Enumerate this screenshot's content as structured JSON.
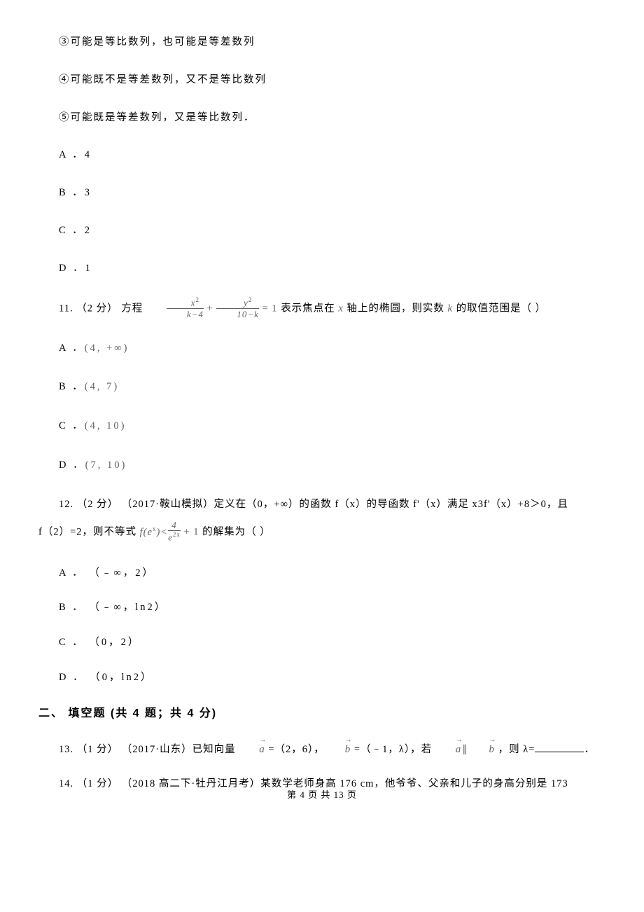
{
  "stmt3": "③可能是等比数列，也可能是等差数列",
  "stmt4": "④可能既不是等差数列，又不是等比数列",
  "stmt5": "⑤可能既是等差数列，又是等比数列．",
  "opt_a4": "A ．4",
  "opt_b3": "B ．3",
  "opt_c2": "C ．2",
  "opt_d1": "D ．1",
  "q11": {
    "prefix": "11.  （2 分） 方程 ",
    "eq_frac1_num": "x",
    "eq_frac1_sup": "2",
    "eq_frac1_den": "k−4",
    "plus": " + ",
    "eq_frac2_num": "y",
    "eq_frac2_sup": "2",
    "eq_frac2_den": "10−k",
    "eq_rhs": " = 1",
    "mid1": " 表示焦点在 ",
    "xvar": "x",
    "mid2": " 轴上的椭圆，则实数 ",
    "kvar": "k",
    "tail": " 的取值范围是（     ）",
    "optA_label": "A ．",
    "optA_val": "(4, +∞)",
    "optB_label": "B ．",
    "optB_val": "(4, 7)",
    "optC_label": "C ．",
    "optC_val": "(4, 10)",
    "optD_label": "D ．",
    "optD_val": "(7, 10)"
  },
  "q12": {
    "line1_a": "12.  （2 分） （2017·鞍山模拟）定义在（0，+∞）的函数 f（x）的导函数 f'（x）满足 x3f'（x）+8＞0，且",
    "line2_a": "f（2）=2，则不等式 ",
    "ineq_lhs": "f(e",
    "ineq_lhs_sup": "x",
    "ineq_lhs_close": ")<",
    "ineq_frac_num": "4",
    "ineq_frac_den_base": "e",
    "ineq_frac_den_sup": "2x",
    "ineq_rhs": " + 1",
    "line2_b": " 的解集为（     ）",
    "optA": "A ． （﹣∞，2）",
    "optB": "B ． （﹣∞，ln2）",
    "optC": "C ． （0，2）",
    "optD": "D ． （0，ln2）"
  },
  "section2": "二、 填空题 (共 4 题；共 4 分)",
  "q13": {
    "prefix": "13.  （1 分） （2017·山东）已知向量 ",
    "vec_a": "a",
    "mid1": " =（2，6），",
    "vec_b": "b",
    "mid2": " =（﹣1，λ），若 ",
    "vec_a2": "a",
    "parallel": "∥",
    "vec_b2": "b",
    "tail1": " ，则 λ=",
    "tail2": "．"
  },
  "q14": {
    "text": "14.  （1 分） （2018 高二下·牡丹江月考）某数学老师身高 176 cm，他爷爷、父亲和儿子的身高分别是 173"
  },
  "footer": "第 4 页 共 13 页"
}
